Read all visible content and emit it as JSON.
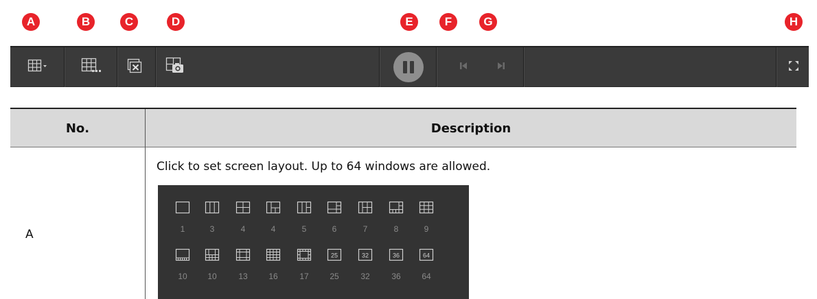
{
  "markers": [
    "A",
    "B",
    "C",
    "D",
    "E",
    "F",
    "G",
    "H"
  ],
  "toolbar": {
    "icons": [
      "screen-layout-icon",
      "custom-layout-icon",
      "close-all-windows-icon",
      "snapshot-icon",
      "pause-icon",
      "previous-frame-icon",
      "next-frame-icon",
      "fullscreen-icon"
    ]
  },
  "table": {
    "header_no": "No.",
    "header_desc": "Description",
    "row": {
      "no": "A",
      "desc": "Click to set screen layout. Up to 64 windows are allowed."
    }
  },
  "layout_panel": {
    "row1": [
      "1",
      "3",
      "4",
      "4",
      "5",
      "6",
      "7",
      "8",
      "9"
    ],
    "row2": [
      "10",
      "10",
      "13",
      "16",
      "17",
      "25",
      "32",
      "36",
      "64"
    ],
    "boxed_labels": [
      "25",
      "32",
      "36",
      "64"
    ]
  },
  "colors": {
    "marker": "#e8232a",
    "toolbar": "#3a3a3a",
    "table_header": "#d9d9d9",
    "panel": "#333333"
  }
}
